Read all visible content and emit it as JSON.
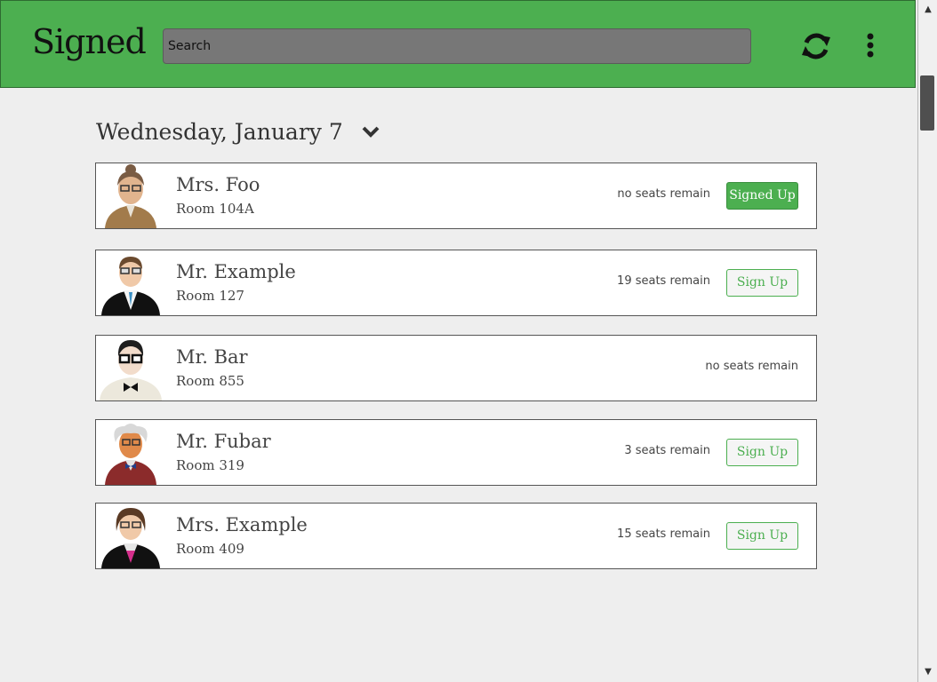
{
  "app": {
    "title": "Signed"
  },
  "search": {
    "placeholder": "Search",
    "value": ""
  },
  "header_icons": {
    "refresh": "refresh-icon",
    "menu": "more-vert-icon"
  },
  "date": {
    "label": "Wednesday, January 7"
  },
  "colors": {
    "accent": "#4caf50",
    "search_bg": "#777777",
    "page_bg": "#eeeeee"
  },
  "teachers": [
    {
      "name": "Mrs. Foo",
      "room": "Room 104A",
      "seats": "no seats remain",
      "button": "Signed Up",
      "state": "signed"
    },
    {
      "name": "Mr. Example",
      "room": "Room 127",
      "seats": "19 seats remain",
      "button": "Sign Up",
      "state": "open"
    },
    {
      "name": "Mr. Bar",
      "room": "Room 855",
      "seats": "no seats remain",
      "button": "",
      "state": "full"
    },
    {
      "name": "Mr. Fubar",
      "room": "Room 319",
      "seats": "3 seats remain",
      "button": "Sign Up",
      "state": "open"
    },
    {
      "name": "Mrs. Example",
      "room": "Room 409",
      "seats": "15 seats remain",
      "button": "Sign Up",
      "state": "open"
    }
  ]
}
